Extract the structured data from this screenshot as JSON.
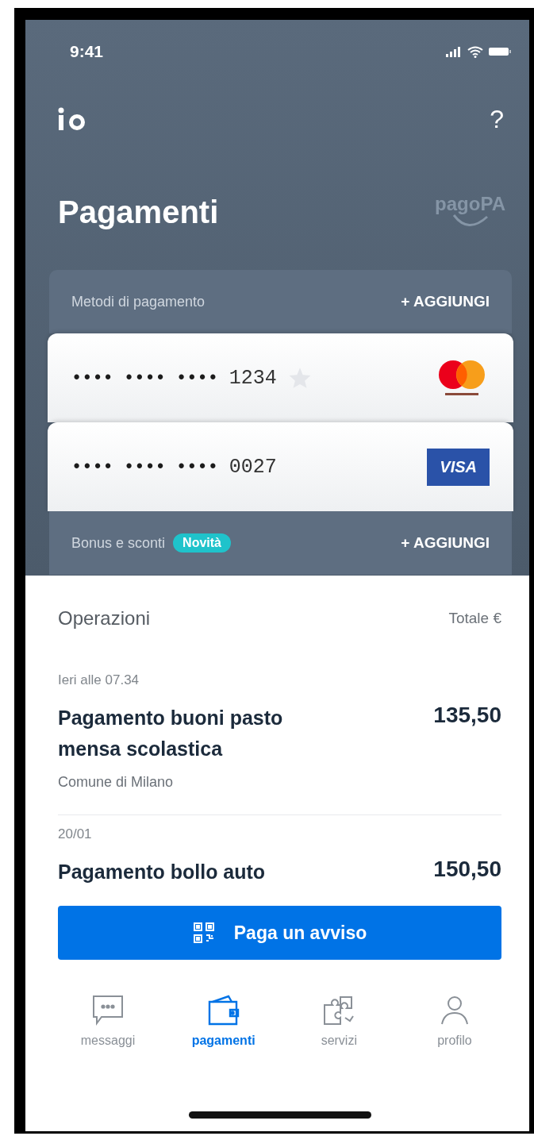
{
  "status_bar": {
    "time": "9:41"
  },
  "header": {
    "help": "?",
    "title": "Pagamenti",
    "logo_text": "pagoPA"
  },
  "payment_methods": {
    "title": "Metodi di pagamento",
    "action": "+ AGGIUNGI",
    "cards": [
      {
        "masked": "•••• •••• ••••",
        "last4": "1234",
        "starred": false,
        "kind": "mastercard"
      },
      {
        "masked": "•••• •••• ••••",
        "last4": "0027",
        "kind": "visa",
        "brand_label": "VISA"
      }
    ]
  },
  "bonus": {
    "title": "Bonus e sconti",
    "badge": "Novità",
    "action": "+ AGGIUNGI"
  },
  "operations": {
    "title": "Operazioni",
    "total_label": "Totale €",
    "items": [
      {
        "date": "Ieri alle 07.34",
        "title": "Pagamento buoni pasto mensa scolastica",
        "amount": "135,50",
        "payee": "Comune di Milano"
      },
      {
        "date": "20/01",
        "title": "Pagamento bollo auto",
        "amount": "150,50"
      }
    ]
  },
  "pay_button": "Paga un avviso",
  "tabs": [
    {
      "label": "messaggi",
      "kind": "chat",
      "selected": false
    },
    {
      "label": "pagamenti",
      "kind": "wallet",
      "selected": true
    },
    {
      "label": "servizi",
      "kind": "puzzle",
      "selected": false
    },
    {
      "label": "profilo",
      "kind": "person",
      "selected": false
    }
  ]
}
